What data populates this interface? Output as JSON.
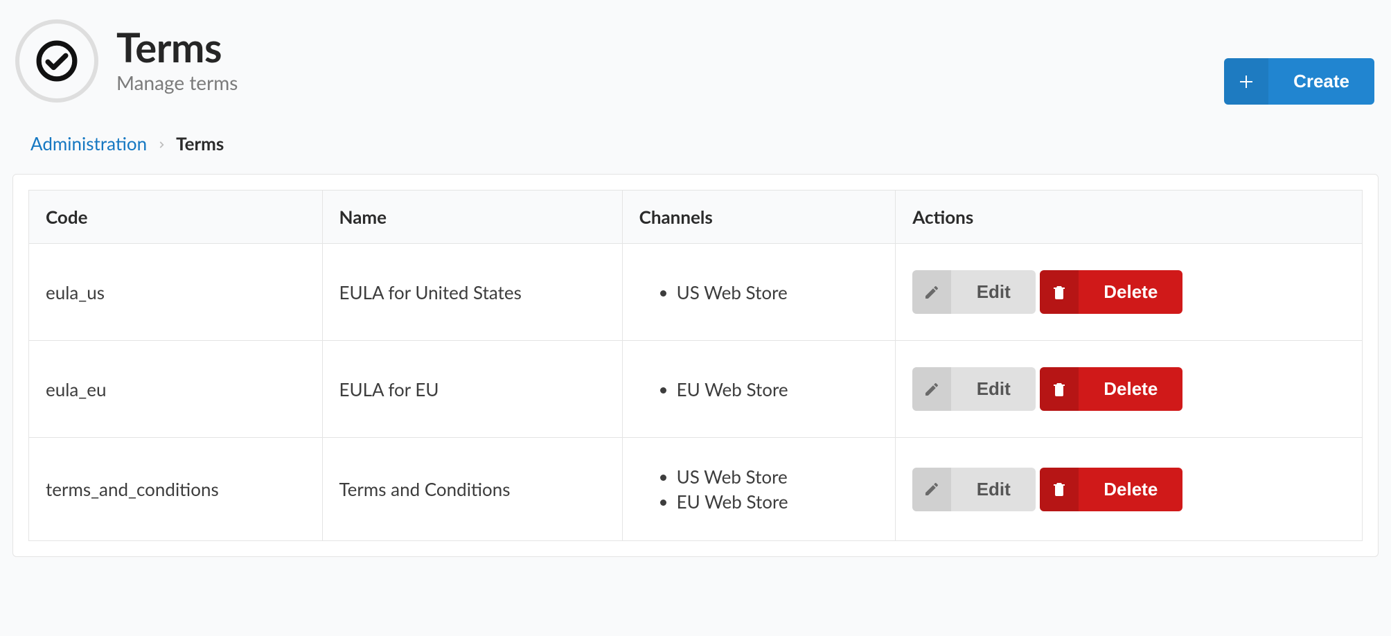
{
  "header": {
    "title": "Terms",
    "subtitle": "Manage terms",
    "create_label": "Create"
  },
  "breadcrumb": {
    "root": "Administration",
    "current": "Terms"
  },
  "table": {
    "headers": {
      "code": "Code",
      "name": "Name",
      "channels": "Channels",
      "actions": "Actions"
    },
    "action_labels": {
      "edit": "Edit",
      "delete": "Delete"
    },
    "rows": [
      {
        "code": "eula_us",
        "name": "EULA for United States",
        "channels": [
          "US Web Store"
        ]
      },
      {
        "code": "eula_eu",
        "name": "EULA for EU",
        "channels": [
          "EU Web Store"
        ]
      },
      {
        "code": "terms_and_conditions",
        "name": "Terms and Conditions",
        "channels": [
          "US Web Store",
          "EU Web Store"
        ]
      }
    ]
  }
}
